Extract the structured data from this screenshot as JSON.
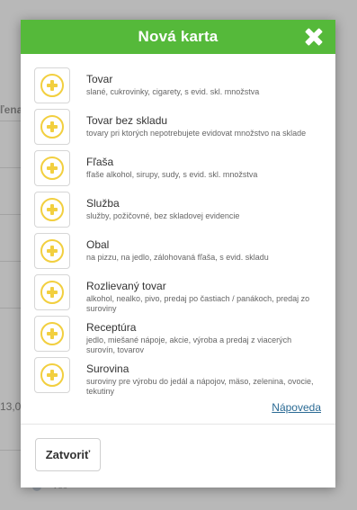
{
  "background": {
    "header_fragment": "ľena",
    "value_fragment": "13,0",
    "radio_label": "Všo"
  },
  "modal": {
    "title": "Nová karta",
    "items": [
      {
        "title": "Tovar",
        "description": "slané, cukrovinky, cigarety, s evid. skl. množstva"
      },
      {
        "title": "Tovar bez skladu",
        "description": "tovary pri ktorých nepotrebujete evidovat množstvo na sklade"
      },
      {
        "title": "Fľaša",
        "description": "fľaše alkohol, sirupy, sudy, s evid. skl. množstva"
      },
      {
        "title": "Služba",
        "description": "služby, požičovné, bez skladovej evidencie"
      },
      {
        "title": "Obal",
        "description": "na pizzu, na jedlo, zálohovaná fľaša, s evid. skladu"
      },
      {
        "title": "Rozlievaný tovar",
        "description": "alkohol, nealko, pivo, predaj po častiach / panákoch, predaj zo suroviny"
      },
      {
        "title": "Receptúra",
        "description": "jedlo, miešané nápoje, akcie, výroba a predaj z viacerých surovín, tovarov"
      },
      {
        "title": "Surovina",
        "description": "suroviny pre výrobu do jedál a nápojov, mäso, zelenina, ovocie, tekutiny"
      }
    ],
    "help_link": "Nápoveda",
    "close_label": "Zatvoriť"
  },
  "colors": {
    "header_green": "#55b93a",
    "plus_yellow": "#f2cf3f",
    "link_blue": "#2a6a94"
  }
}
